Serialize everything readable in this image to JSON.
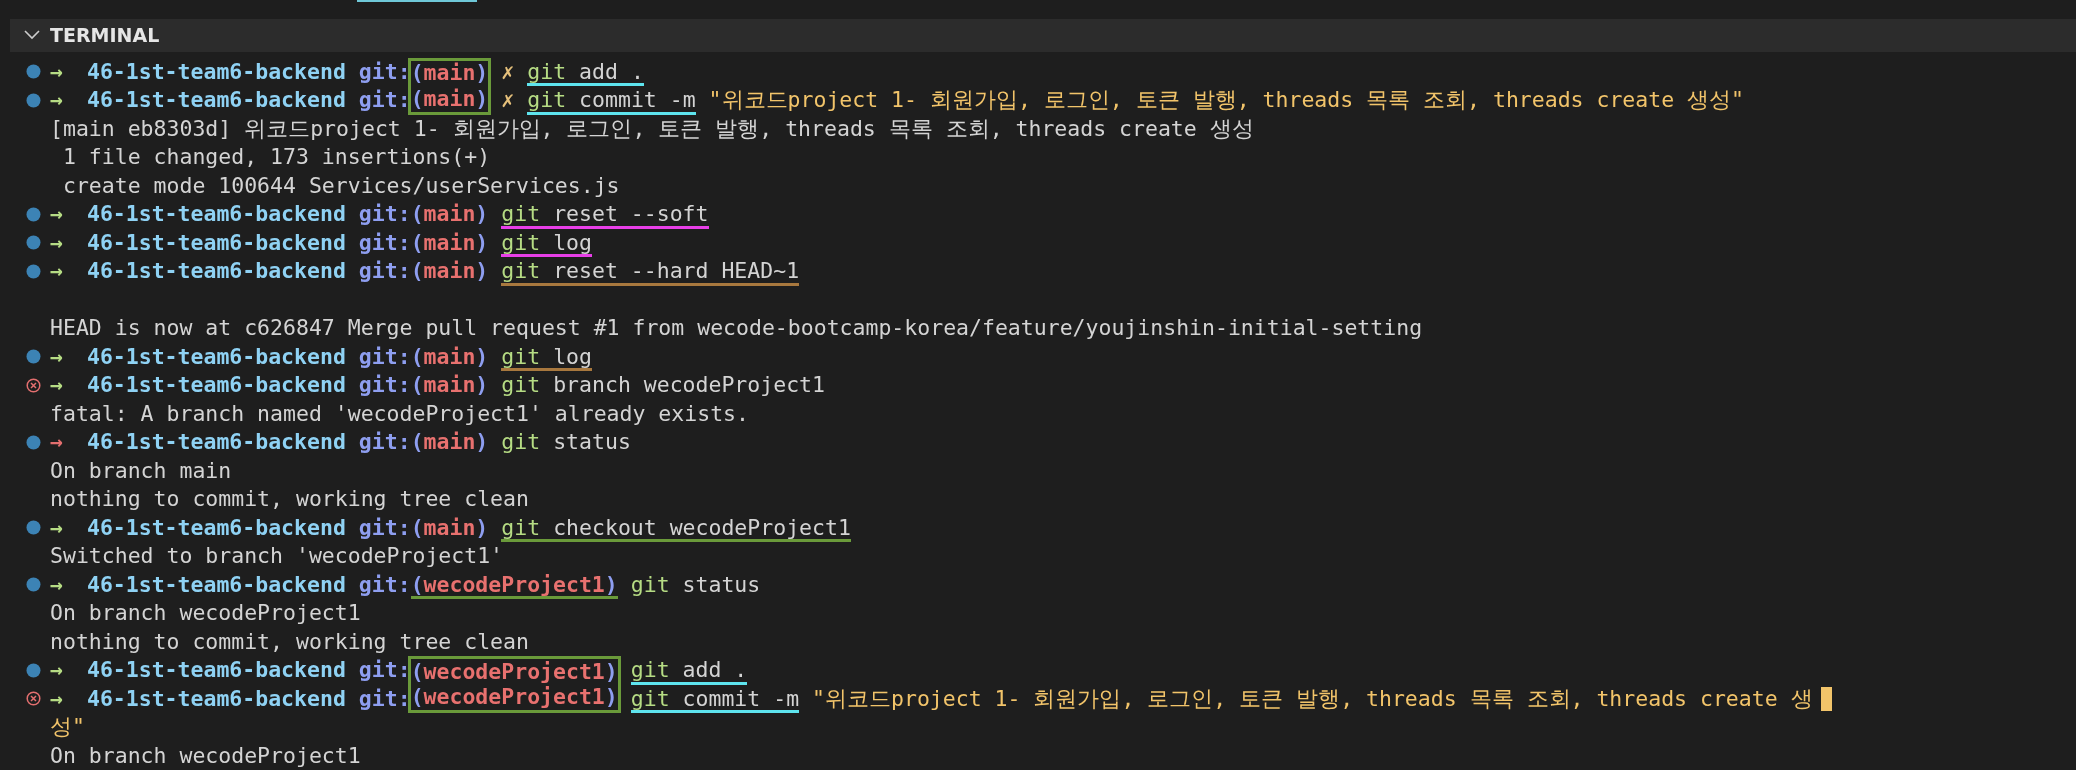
{
  "panel": {
    "title": "TERMINAL",
    "expanded": true
  },
  "lines": [
    {
      "kind": "prompt",
      "failed": false,
      "arrow": "→",
      "arrow_ok": true,
      "dir": "46-1st-team6-backend",
      "git_label": "git:",
      "open": "(",
      "branch": "main",
      "close": ")",
      "dirty": "✗",
      "program": "git",
      "args": "add .",
      "boxed": true,
      "underline": {
        "color": "#5ee4ee",
        "kind": "command"
      }
    },
    {
      "kind": "prompt",
      "failed": false,
      "arrow": "→",
      "arrow_ok": true,
      "dir": "46-1st-team6-backend",
      "git_label": "git:",
      "open": "(",
      "branch": "main",
      "close": ")",
      "dirty": "✗",
      "program": "git",
      "args": "commit -m",
      "message": "\"위코드project 1- 회원가입, 로그인, 토큰 발행, threads 목록 조회, threads create 생성\"",
      "boxed": true,
      "underline": {
        "color": "#5ee4ee",
        "kind": "command"
      }
    },
    {
      "kind": "output",
      "text": "[main eb8303d] 위코드project 1- 회원가입, 로그인, 토큰 발행, threads 목록 조회, threads create 생성"
    },
    {
      "kind": "output",
      "text": " 1 file changed, 173 insertions(+)"
    },
    {
      "kind": "output",
      "text": " create mode 100644 Services/userServices.js"
    },
    {
      "kind": "prompt",
      "failed": false,
      "arrow": "→",
      "arrow_ok": true,
      "dir": "46-1st-team6-backend",
      "git_label": "git:",
      "open": "(",
      "branch": "main",
      "close": ")",
      "program": "git",
      "args": "reset --soft",
      "boxed": false,
      "underline": {
        "color": "#e83fe8",
        "kind": "command"
      }
    },
    {
      "kind": "prompt",
      "failed": false,
      "arrow": "→",
      "arrow_ok": true,
      "dir": "46-1st-team6-backend",
      "git_label": "git:",
      "open": "(",
      "branch": "main",
      "close": ")",
      "program": "git",
      "args": "log",
      "boxed": false,
      "underline": {
        "color": "#e83fe8",
        "kind": "command"
      }
    },
    {
      "kind": "prompt",
      "failed": false,
      "arrow": "→",
      "arrow_ok": true,
      "dir": "46-1st-team6-backend",
      "git_label": "git:",
      "open": "(",
      "branch": "main",
      "close": ")",
      "program": "git",
      "args": "reset --hard HEAD~1",
      "boxed": false,
      "underline": {
        "color": "#a8783e",
        "kind": "command"
      }
    },
    {
      "kind": "blank"
    },
    {
      "kind": "output",
      "text": "HEAD is now at c626847 Merge pull request #1 from wecode-bootcamp-korea/feature/youjinshin-initial-setting"
    },
    {
      "kind": "prompt",
      "failed": false,
      "arrow": "→",
      "arrow_ok": true,
      "dir": "46-1st-team6-backend",
      "git_label": "git:",
      "open": "(",
      "branch": "main",
      "close": ")",
      "program": "git",
      "args": "log",
      "boxed": false,
      "underline": {
        "color": "#a8783e",
        "kind": "command"
      }
    },
    {
      "kind": "prompt",
      "failed": true,
      "arrow": "→",
      "arrow_ok": true,
      "dir": "46-1st-team6-backend",
      "git_label": "git:",
      "open": "(",
      "branch": "main",
      "close": ")",
      "program": "git",
      "args": "branch wecodeProject1",
      "boxed": false
    },
    {
      "kind": "output",
      "text": "fatal: A branch named 'wecodeProject1' already exists."
    },
    {
      "kind": "prompt",
      "failed": false,
      "arrow": "→",
      "arrow_ok": false,
      "dir": "46-1st-team6-backend",
      "git_label": "git:",
      "open": "(",
      "branch": "main",
      "close": ")",
      "program": "git",
      "args": "status",
      "boxed": false
    },
    {
      "kind": "output",
      "text": "On branch main"
    },
    {
      "kind": "output",
      "text": "nothing to commit, working tree clean"
    },
    {
      "kind": "prompt",
      "failed": false,
      "arrow": "→",
      "arrow_ok": true,
      "dir": "46-1st-team6-backend",
      "git_label": "git:",
      "open": "(",
      "branch": "main",
      "close": ")",
      "program": "git",
      "args": "checkout wecodeProject1",
      "boxed": false,
      "underline": {
        "color": "#6a9a3a",
        "kind": "command"
      }
    },
    {
      "kind": "output",
      "text": "Switched to branch 'wecodeProject1'"
    },
    {
      "kind": "prompt",
      "failed": false,
      "arrow": "→",
      "arrow_ok": true,
      "dir": "46-1st-team6-backend",
      "git_label": "git:",
      "open": "(",
      "branch": "wecodeProject1",
      "close": ")",
      "program": "git",
      "args": "status",
      "boxed": false,
      "underline": {
        "color": "#6a9a3a",
        "kind": "branch"
      }
    },
    {
      "kind": "output",
      "text": "On branch wecodeProject1"
    },
    {
      "kind": "output",
      "text": "nothing to commit, working tree clean"
    },
    {
      "kind": "prompt",
      "failed": false,
      "arrow": "→",
      "arrow_ok": true,
      "dir": "46-1st-team6-backend",
      "git_label": "git:",
      "open": "(",
      "branch": "wecodeProject1",
      "close": ")",
      "program": "git",
      "args": "add .",
      "boxed": true,
      "underline": {
        "color": "#5ee4ee",
        "kind": "command"
      }
    },
    {
      "kind": "prompt",
      "failed": true,
      "arrow": "→",
      "arrow_ok": true,
      "dir": "46-1st-team6-backend",
      "git_label": "git:",
      "open": "(",
      "branch": "wecodeProject1",
      "close": ")",
      "program": "git",
      "args": "commit -m",
      "message": "\"위코드project 1- 회원가입, 로그인, 토큰 발행, threads 목록 조회, threads create 생",
      "boxed": true,
      "underline": {
        "color": "#5ee4ee",
        "kind": "command"
      },
      "cursor": true
    },
    {
      "kind": "continuation",
      "text": "성\""
    },
    {
      "kind": "output",
      "text": "On branch wecodeProject1"
    }
  ]
}
